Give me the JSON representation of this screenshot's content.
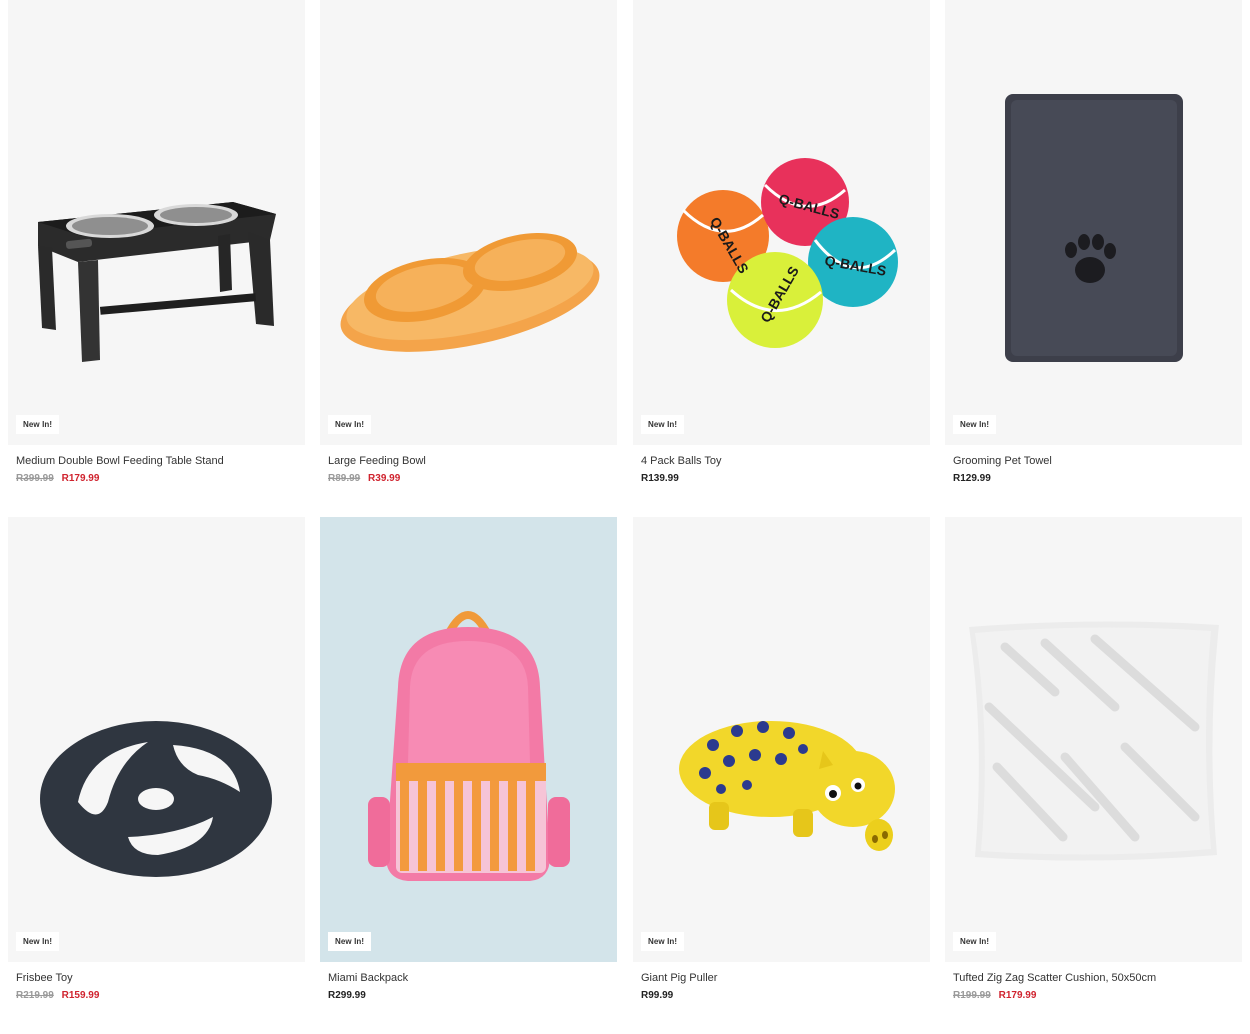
{
  "products": [
    {
      "name": "Medium Double Bowl Feeding Table Stand",
      "badge": "New In!",
      "old_price": "R399.99",
      "price": "R179.99",
      "on_sale": true,
      "image_icon": "elevated-double-bowl-stand"
    },
    {
      "name": "Large Feeding Bowl",
      "badge": "New In!",
      "old_price": "R89.99",
      "price": "R39.99",
      "on_sale": true,
      "image_icon": "orange-double-feeding-bowl"
    },
    {
      "name": "4 Pack Balls Toy",
      "badge": "New In!",
      "price": "R139.99",
      "on_sale": false,
      "image_icon": "tennis-balls"
    },
    {
      "name": "Grooming Pet Towel",
      "badge": "New In!",
      "price": "R129.99",
      "on_sale": false,
      "image_icon": "grey-paw-towel"
    },
    {
      "name": "Frisbee Toy",
      "badge": "New In!",
      "old_price": "R219.99",
      "price": "R159.99",
      "on_sale": true,
      "image_icon": "rubber-frisbee"
    },
    {
      "name": "Miami Backpack",
      "badge": "New In!",
      "price": "R299.99",
      "on_sale": false,
      "image_icon": "pink-striped-backpack"
    },
    {
      "name": "Giant Pig Puller",
      "badge": "New In!",
      "price": "R99.99",
      "on_sale": false,
      "image_icon": "yellow-spotted-pig-toy"
    },
    {
      "name": "Tufted Zig Zag Scatter Cushion, 50x50cm",
      "badge": "New In!",
      "old_price": "R199.99",
      "price": "R179.99",
      "on_sale": true,
      "image_icon": "white-tufted-cushion"
    }
  ],
  "ball_label": "Q-BALLS",
  "colors": {
    "sale": "#d0232e",
    "strike": "#9a9a9a",
    "tile_bg": "#f6f6f6"
  }
}
